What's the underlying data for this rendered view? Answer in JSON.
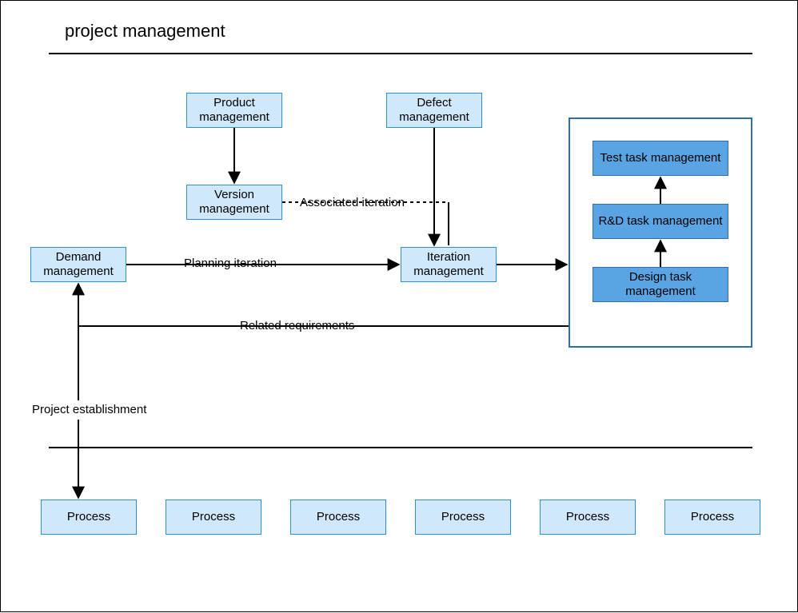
{
  "title": "project management",
  "nodes": {
    "demand": "Demand management",
    "product": "Product management",
    "version": "Version management",
    "defect": "Defect management",
    "iteration": "Iteration management",
    "test": "Test task management",
    "rd": "R&D task management",
    "design": "Design task management"
  },
  "edges": {
    "planning": "Planning iteration",
    "associated": "Associated iteration",
    "related": "Related requirements",
    "establishment": "Project establishment"
  },
  "processes": [
    "Process",
    "Process",
    "Process",
    "Process",
    "Process",
    "Process"
  ]
}
